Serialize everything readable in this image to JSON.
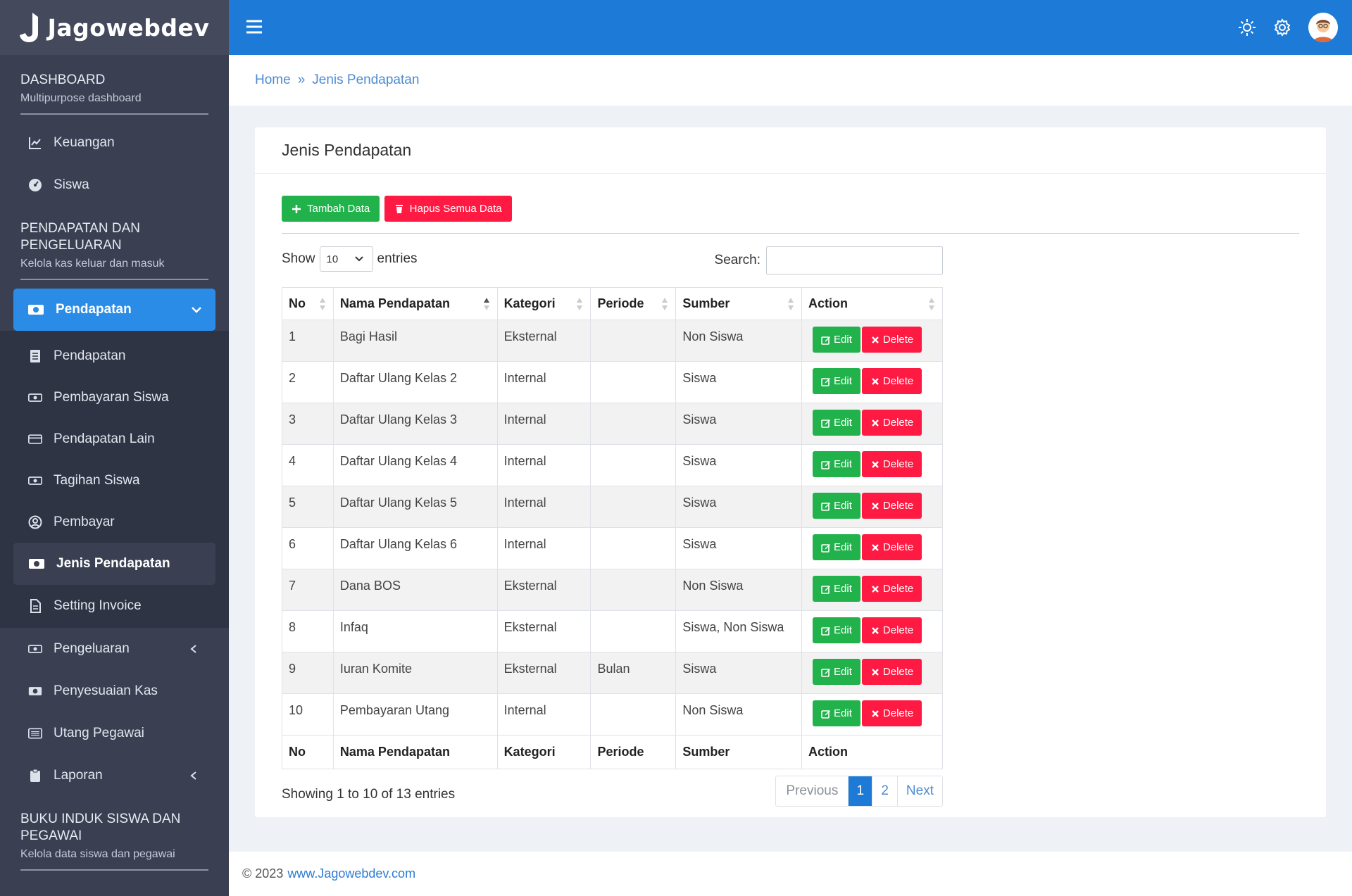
{
  "brand": {
    "name": "Jagowebdev"
  },
  "sidebar": {
    "dashboard": {
      "title": "DASHBOARD",
      "subtitle": "Multipurpose dashboard"
    },
    "dashboard_items": [
      {
        "label": "Keuangan",
        "icon": "chart-line-icon"
      },
      {
        "label": "Siswa",
        "icon": "gauge-icon"
      }
    ],
    "finance": {
      "title": "PENDAPATAN DAN PENGELUARAN",
      "subtitle": "Kelola kas keluar dan masuk"
    },
    "active_group": {
      "label": "Pendapatan",
      "icon": "money-icon"
    },
    "submenu": [
      {
        "label": "Pendapatan",
        "icon": "list-icon"
      },
      {
        "label": "Pembayaran Siswa",
        "icon": "money-icon"
      },
      {
        "label": "Pendapatan Lain",
        "icon": "card-icon"
      },
      {
        "label": "Tagihan Siswa",
        "icon": "money-icon"
      },
      {
        "label": "Pembayar",
        "icon": "user-circle-icon"
      }
    ],
    "submenu_current": {
      "label": "Jenis Pendapatan",
      "icon": "money-icon"
    },
    "submenu_after": [
      {
        "label": "Setting Invoice",
        "icon": "file-icon"
      }
    ],
    "other_items": [
      {
        "label": "Pengeluaran",
        "icon": "money-icon",
        "has_children": true
      },
      {
        "label": "Penyesuaian Kas",
        "icon": "money-icon",
        "has_children": false
      },
      {
        "label": "Utang Pegawai",
        "icon": "list-alt-icon",
        "has_children": false
      },
      {
        "label": "Laporan",
        "icon": "clipboard-icon",
        "has_children": true
      }
    ],
    "students": {
      "title": "BUKU INDUK SISWA DAN PEGAWAI",
      "subtitle": "Kelola data siswa dan pegawai"
    }
  },
  "breadcrumb": {
    "home": "Home",
    "separator": "»",
    "current": "Jenis Pendapatan"
  },
  "card": {
    "title": "Jenis Pendapatan",
    "add_button": "Tambah Data",
    "delete_all_button": "Hapus Semua Data"
  },
  "table_controls": {
    "show_label": "Show",
    "entries_value": "10",
    "entries_label": "entries",
    "search_label": "Search:",
    "search_value": ""
  },
  "table": {
    "columns": [
      "No",
      "Nama Pendapatan",
      "Kategori",
      "Periode",
      "Sumber",
      "Action"
    ],
    "rows": [
      {
        "no": "1",
        "nama": "Bagi Hasil",
        "kategori": "Eksternal",
        "periode": "",
        "sumber": "Non Siswa"
      },
      {
        "no": "2",
        "nama": "Daftar Ulang Kelas 2",
        "kategori": "Internal",
        "periode": "",
        "sumber": "Siswa"
      },
      {
        "no": "3",
        "nama": "Daftar Ulang Kelas 3",
        "kategori": "Internal",
        "periode": "",
        "sumber": "Siswa"
      },
      {
        "no": "4",
        "nama": "Daftar Ulang Kelas 4",
        "kategori": "Internal",
        "periode": "",
        "sumber": "Siswa"
      },
      {
        "no": "5",
        "nama": "Daftar Ulang Kelas 5",
        "kategori": "Internal",
        "periode": "",
        "sumber": "Siswa"
      },
      {
        "no": "6",
        "nama": "Daftar Ulang Kelas 6",
        "kategori": "Internal",
        "periode": "",
        "sumber": "Siswa"
      },
      {
        "no": "7",
        "nama": "Dana BOS",
        "kategori": "Eksternal",
        "periode": "",
        "sumber": "Non Siswa"
      },
      {
        "no": "8",
        "nama": "Infaq",
        "kategori": "Eksternal",
        "periode": "",
        "sumber": "Siswa, Non Siswa"
      },
      {
        "no": "9",
        "nama": "Iuran Komite",
        "kategori": "Eksternal",
        "periode": "Bulan",
        "sumber": "Siswa"
      },
      {
        "no": "10",
        "nama": "Pembayaran Utang",
        "kategori": "Internal",
        "periode": "",
        "sumber": "Non Siswa"
      }
    ],
    "edit_label": "Edit",
    "delete_label": "Delete"
  },
  "pagination": {
    "info": "Showing 1 to 10 of 13 entries",
    "previous": "Previous",
    "pages": [
      "1",
      "2"
    ],
    "current_page": "1",
    "next": "Next"
  },
  "footer": {
    "copyright": "© 2023",
    "link": "www.Jagowebdev.com"
  },
  "colors": {
    "topbar": "#1d7ad6",
    "sidebar": "#3a4052",
    "active": "#2b8ce8",
    "green": "#22b24c",
    "red": "#ff1a43"
  }
}
